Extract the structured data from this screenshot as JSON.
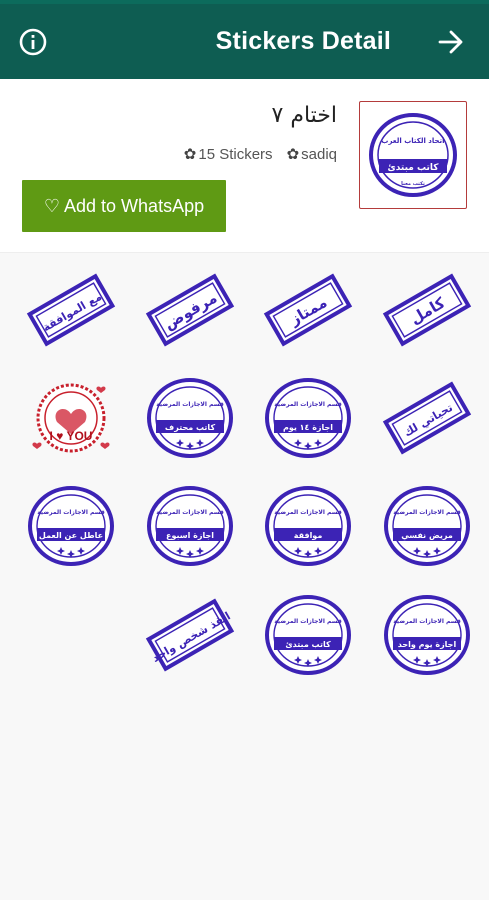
{
  "appbar": {
    "title": "Stickers Detail",
    "info_icon": "info-circle-icon",
    "next_icon": "arrow-right-icon"
  },
  "pack": {
    "name": "اختام ٧",
    "stickers_count": "15 Stickers",
    "author": "sadiq",
    "add_label": "♡ Add to WhatsApp"
  },
  "colors": {
    "appbar": "#0e5d52",
    "button": "#5f9a14",
    "stamp_ink": "#3c23b5",
    "tray_border": "#b43b3b"
  },
  "stickers": [
    {
      "type": "rect",
      "text": "كامل"
    },
    {
      "type": "rect",
      "text": "ممتاز"
    },
    {
      "type": "rect",
      "text": "مرفوض"
    },
    {
      "type": "rect",
      "text": "مع الموافقة"
    },
    {
      "type": "rect",
      "text": "تحياتي لك"
    },
    {
      "type": "round",
      "text": "اجازة ١٤ يوم"
    },
    {
      "type": "round",
      "text": "كاتب محترف"
    },
    {
      "type": "heart",
      "text": "I ♥ YOU"
    },
    {
      "type": "round",
      "text": "مريض نفسي"
    },
    {
      "type": "round",
      "text": "موافقة"
    },
    {
      "type": "round",
      "text": "اجازة اسبوع"
    },
    {
      "type": "round",
      "text": "عاطل عن العمل"
    },
    {
      "type": "round",
      "text": "اجازة يوم واحد"
    },
    {
      "type": "round",
      "text": "كاتب مبتدئ"
    },
    {
      "type": "rect",
      "text": "انقذ شخص واحد"
    }
  ],
  "tray_text": "كاتب مبتدئ"
}
